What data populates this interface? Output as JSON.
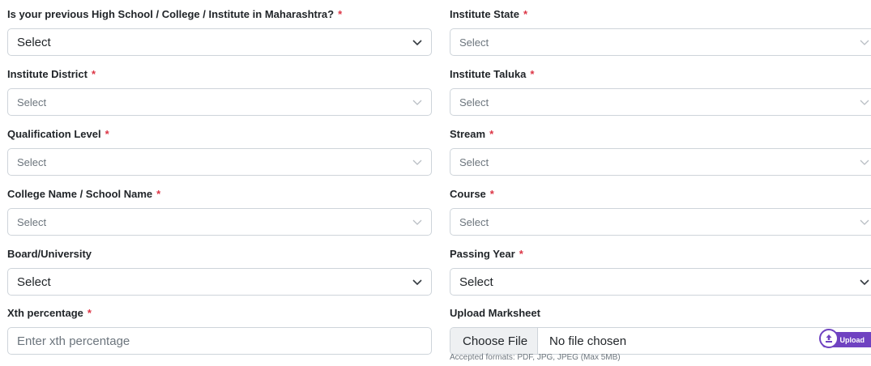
{
  "form": {
    "prev_in_maharashtra": {
      "label": "Is your previous High School / College / Institute in Maharashtra?",
      "value": "Select",
      "required": "*"
    },
    "institute_state": {
      "label": "Institute State",
      "value": "Select",
      "required": "*"
    },
    "institute_district": {
      "label": "Institute District",
      "value": "Select",
      "required": "*"
    },
    "institute_taluka": {
      "label": "Institute Taluka",
      "value": "Select",
      "required": "*"
    },
    "qualification_level": {
      "label": "Qualification Level",
      "value": "Select",
      "required": "*"
    },
    "stream": {
      "label": "Stream",
      "value": "Select",
      "required": "*"
    },
    "college_name": {
      "label": "College Name / School Name",
      "value": "Select",
      "required": "*"
    },
    "course": {
      "label": "Course",
      "value": "Select",
      "required": "*"
    },
    "board_university": {
      "label": "Board/University",
      "value": "Select"
    },
    "passing_year": {
      "label": "Passing Year",
      "value": "Select",
      "required": "*"
    },
    "xth_percentage": {
      "label": "Xth percentage",
      "placeholder": "Enter xth percentage",
      "required": "*"
    },
    "upload_marksheet": {
      "label": "Upload Marksheet",
      "choose_file_label": "Choose File",
      "file_status": "No file chosen",
      "upload_button_label": "Upload",
      "help_text": "Accepted formats: PDF, JPG, JPEG (Max 5MB)"
    }
  },
  "icons": {
    "dropdown": "chevron-down-icon",
    "upload": "upload-icon"
  },
  "colors": {
    "required": "#dc3545",
    "upload_accent": "#6f42c1"
  }
}
